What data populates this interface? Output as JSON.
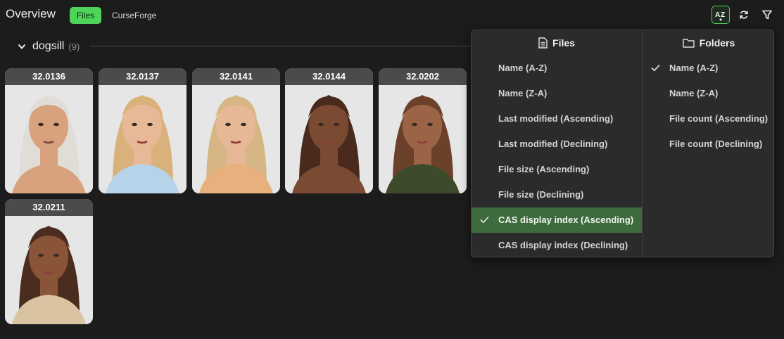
{
  "header": {
    "title": "Overview",
    "tabs": [
      {
        "label": "Files",
        "active": true
      },
      {
        "label": "CurseForge",
        "active": false
      }
    ],
    "tools": [
      "sort-az-icon",
      "refresh-icon",
      "filter-icon"
    ]
  },
  "group": {
    "name": "dogsill",
    "count": "(9)"
  },
  "cards": [
    {
      "label": "32.0136",
      "hair": "#e0ddd6",
      "skin": "#d9a27e",
      "bg": "#e6e6e6",
      "shirt": "#d9a27e"
    },
    {
      "label": "32.0137",
      "hair": "#d8b27a",
      "skin": "#e8b996",
      "bg": "#e6e6e6",
      "shirt": "#b7d3ea"
    },
    {
      "label": "32.0141",
      "hair": "#d6b684",
      "skin": "#e6b895",
      "bg": "#e6e6e6",
      "shirt": "#e8b07c"
    },
    {
      "label": "32.0144",
      "hair": "#4a2a1c",
      "skin": "#7a4a33",
      "bg": "#e6e6e6",
      "shirt": "#7a4a33"
    },
    {
      "label": "32.0202",
      "hair": "#6b4129",
      "skin": "#9c6447",
      "bg": "#e6e6e6",
      "shirt": "#3d4a2c"
    },
    {
      "label": "32.0211",
      "hair": "#4b2d1f",
      "skin": "#8a5438",
      "bg": "#e6e6e6",
      "shirt": "#d9c3a1"
    }
  ],
  "sort_menu": {
    "files": {
      "heading": "Files",
      "items": [
        {
          "label": "Name (A-Z)",
          "selected": false
        },
        {
          "label": "Name (Z-A)",
          "selected": false
        },
        {
          "label": "Last modified (Ascending)",
          "selected": false
        },
        {
          "label": "Last modified (Declining)",
          "selected": false
        },
        {
          "label": "File size (Ascending)",
          "selected": false
        },
        {
          "label": "File size (Declining)",
          "selected": false
        },
        {
          "label": "CAS display index (Ascending)",
          "selected": true
        },
        {
          "label": "CAS display index (Declining)",
          "selected": false
        }
      ]
    },
    "folders": {
      "heading": "Folders",
      "items": [
        {
          "label": "Name (A-Z)",
          "selected": true
        },
        {
          "label": "Name (Z-A)",
          "selected": false
        },
        {
          "label": "File count (Ascending)",
          "selected": false
        },
        {
          "label": "File count (Declining)",
          "selected": false
        }
      ]
    }
  },
  "colors": {
    "accent": "#4fd35b",
    "selected_row": "#3d6b3e",
    "background": "#1c1c1c",
    "menu_bg": "#2b2b2b"
  }
}
